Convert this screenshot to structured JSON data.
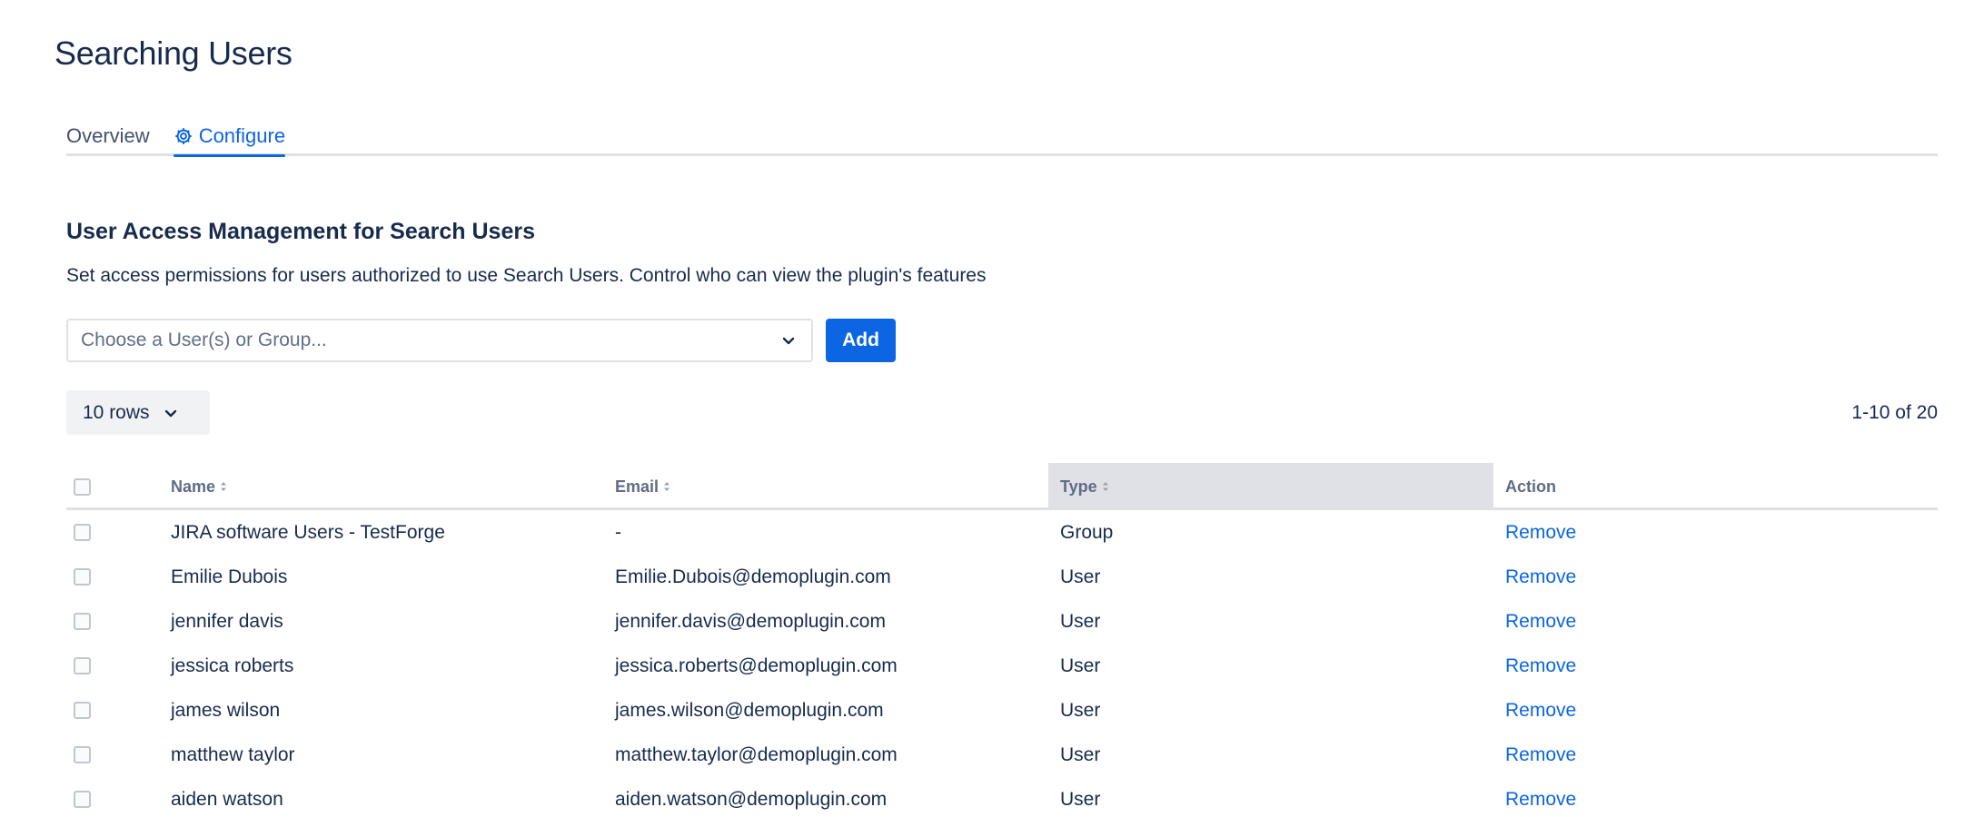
{
  "page": {
    "title": "Searching Users"
  },
  "tabs": [
    {
      "label": "Overview",
      "active": false
    },
    {
      "label": "Configure",
      "active": true,
      "icon": "gear-icon"
    }
  ],
  "section": {
    "title": "User Access Management for Search Users",
    "description": "Set access permissions for users authorized to use Search Users. Control who can view the plugin's features"
  },
  "picker": {
    "placeholder": "Choose a User(s) or Group...",
    "icon": "chevron-down-icon"
  },
  "add_button": {
    "label": "Add"
  },
  "rows_select": {
    "label": "10 rows"
  },
  "pager": {
    "text": "1-10 of 20"
  },
  "colors": {
    "accent": "#0c66e4",
    "text": "#172b4d",
    "muted": "#5e6c84",
    "border": "#dfe1e6"
  },
  "table": {
    "columns": [
      {
        "label": "Name",
        "sortable": true
      },
      {
        "label": "Email",
        "sortable": true
      },
      {
        "label": "Type",
        "sortable": true,
        "highlighted": true
      },
      {
        "label": "Action",
        "sortable": false
      }
    ],
    "rows": [
      {
        "name": "JIRA software Users - TestForge",
        "email": "-",
        "type": "Group",
        "action": "Remove"
      },
      {
        "name": "Emilie Dubois",
        "email": "Emilie.Dubois@demoplugin.com",
        "type": "User",
        "action": "Remove"
      },
      {
        "name": "jennifer davis",
        "email": "jennifer.davis@demoplugin.com",
        "type": "User",
        "action": "Remove"
      },
      {
        "name": "jessica roberts",
        "email": "jessica.roberts@demoplugin.com",
        "type": "User",
        "action": "Remove"
      },
      {
        "name": "james wilson",
        "email": "james.wilson@demoplugin.com",
        "type": "User",
        "action": "Remove"
      },
      {
        "name": "matthew taylor",
        "email": "matthew.taylor@demoplugin.com",
        "type": "User",
        "action": "Remove"
      },
      {
        "name": "aiden watson",
        "email": "aiden.watson@demoplugin.com",
        "type": "User",
        "action": "Remove"
      }
    ]
  }
}
